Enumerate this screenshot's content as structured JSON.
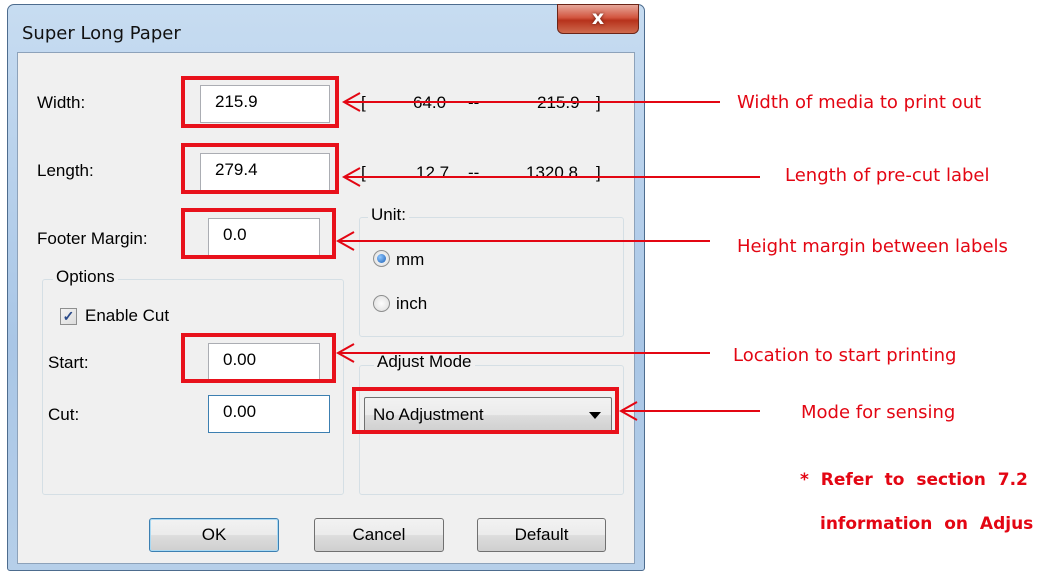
{
  "window": {
    "title": "Super Long Paper",
    "close_label": "x"
  },
  "fields": {
    "width": {
      "label": "Width:",
      "value": "215.9",
      "range_open": "[",
      "range_min": "64.0",
      "range_dash": "--",
      "range_max": "215.9",
      "range_close": "]"
    },
    "length": {
      "label": "Length:",
      "value": "279.4",
      "range_open": "[",
      "range_min": "12.7",
      "range_dash": "--",
      "range_max": "1320.8",
      "range_close": "]"
    },
    "footer_margin": {
      "label": "Footer Margin:",
      "value": "0.0"
    }
  },
  "options": {
    "group_title": "Options",
    "enable_cut_label": "Enable Cut",
    "enable_cut_checked": true,
    "start_label": "Start:",
    "start_value": "0.00",
    "cut_label": "Cut:",
    "cut_value": "0.00"
  },
  "unit": {
    "group_title": "Unit:",
    "options": [
      "mm",
      "inch"
    ],
    "selected": "mm"
  },
  "adjust_mode": {
    "group_title": "Adjust Mode",
    "selected": "No Adjustment"
  },
  "buttons": {
    "ok": "OK",
    "cancel": "Cancel",
    "default": "Default"
  },
  "annotations": {
    "width": "Width of media to print out",
    "length": "Length of pre-cut label",
    "footer": "Height margin between labels",
    "start": "Location to start printing",
    "mode": "Mode for sensing",
    "note_line1": "* Refer to section 7.2",
    "note_line2": "information on Adjus"
  },
  "colors": {
    "annotation_red": "#e30613",
    "highlight_red": "#e8111b",
    "dialog_bg": "#f0f0f0"
  }
}
